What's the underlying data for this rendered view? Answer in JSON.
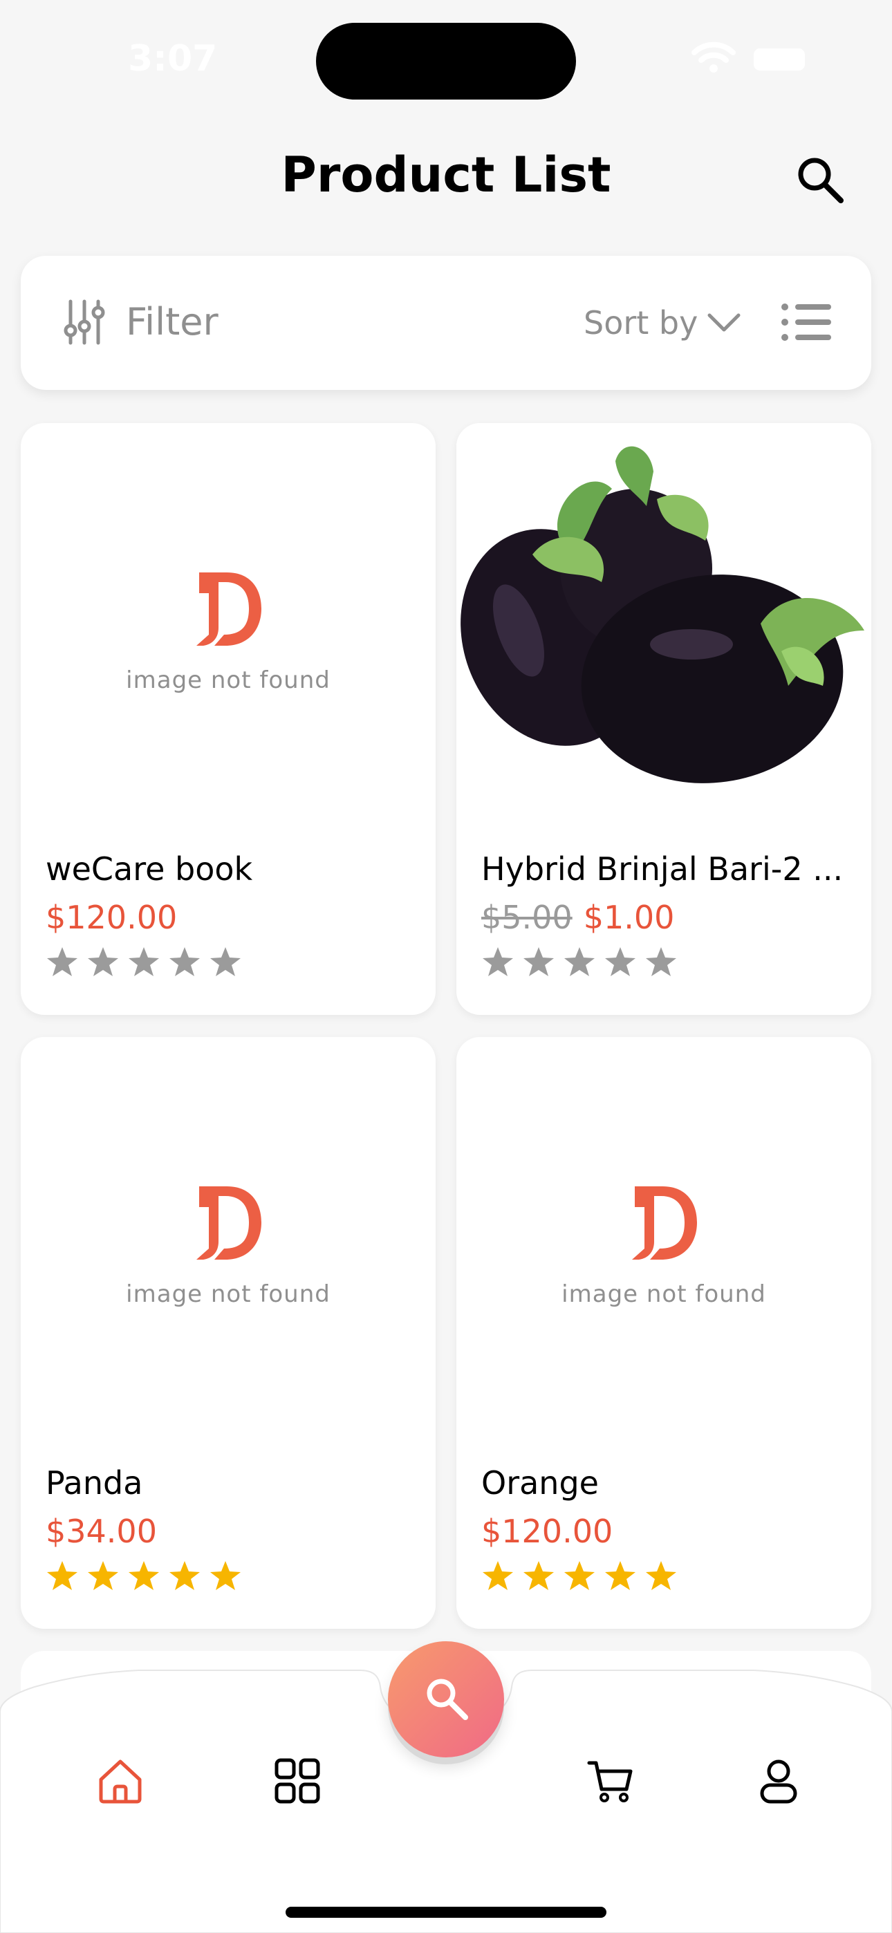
{
  "status_bar": {
    "time": "3:07"
  },
  "header": {
    "title": "Product List"
  },
  "filter_bar": {
    "filter_label": "Filter",
    "sort_label": "Sort by"
  },
  "image_placeholder_text": "image not found",
  "products": [
    {
      "name": "weCare book",
      "old_price": "",
      "price": "$120.00",
      "rating": 0,
      "has_image": false
    },
    {
      "name": "Hybrid Brinjal Bari-2 ...",
      "old_price": "$5.00",
      "price": "$1.00",
      "rating": 0,
      "has_image": true
    },
    {
      "name": "Panda",
      "old_price": "",
      "price": "$34.00",
      "rating": 5,
      "has_image": false
    },
    {
      "name": "Orange",
      "old_price": "",
      "price": "$120.00",
      "rating": 5,
      "has_image": false
    }
  ],
  "colors": {
    "accent": "#e8543a",
    "star_filled": "#f7b500",
    "star_empty": "#9b9b9b",
    "fab_gradient_start": "#f79a6d",
    "fab_gradient_end": "#f06a86"
  },
  "bottom_nav": {
    "items": [
      "home-icon",
      "grid-icon",
      "search-icon",
      "cart-icon",
      "profile-icon"
    ],
    "active": "home-icon"
  }
}
